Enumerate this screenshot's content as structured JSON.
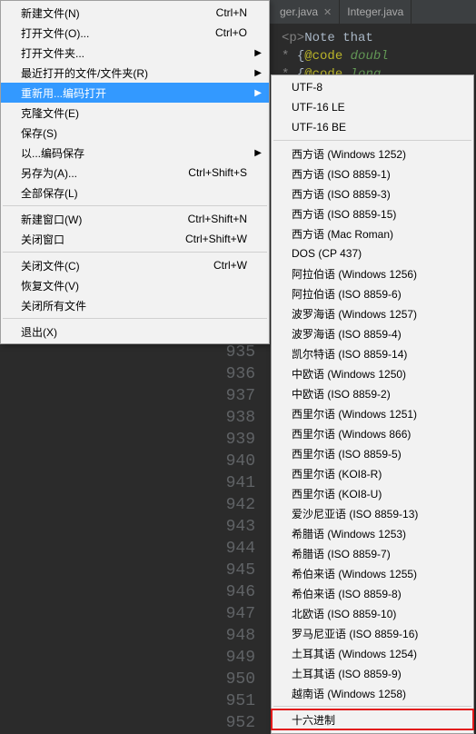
{
  "tabs": [
    {
      "label": "ger.java"
    },
    {
      "label": "Integer.java"
    }
  ],
  "code_top": {
    "l1_prefix": "<p>",
    "l1_text": "Note  that",
    "l2_star": "*",
    "l2_ann": "@code",
    "l2_kw": "doubl",
    "l3_star": "*",
    "l3_ann": "@code",
    "l3_kw": "long"
  },
  "gutter": [
    "935",
    "936",
    "937",
    "938",
    "939",
    "940",
    "941",
    "942",
    "943",
    "944",
    "945",
    "946",
    "947",
    "948",
    "949",
    "950",
    "951",
    "952"
  ],
  "menu": {
    "items": [
      {
        "label": "新建文件(N)",
        "shortcut": "Ctrl+N"
      },
      {
        "label": "打开文件(O)...",
        "shortcut": "Ctrl+O"
      },
      {
        "label": "打开文件夹...",
        "shortcut": "",
        "submenu": true
      },
      {
        "label": "最近打开的文件/文件夹(R)",
        "shortcut": "",
        "submenu": true
      },
      {
        "label": "重新用...编码打开",
        "shortcut": "",
        "submenu": true,
        "highlight": true
      },
      {
        "label": "克隆文件(E)",
        "shortcut": ""
      },
      {
        "label": "保存(S)",
        "shortcut": ""
      },
      {
        "label": "以...编码保存",
        "shortcut": "",
        "submenu": true
      },
      {
        "label": "另存为(A)...",
        "shortcut": "Ctrl+Shift+S"
      },
      {
        "label": "全部保存(L)",
        "shortcut": ""
      },
      {
        "sep": true
      },
      {
        "label": "新建窗口(W)",
        "shortcut": "Ctrl+Shift+N"
      },
      {
        "label": "关闭窗口",
        "shortcut": "Ctrl+Shift+W"
      },
      {
        "sep": true
      },
      {
        "label": "关闭文件(C)",
        "shortcut": "Ctrl+W"
      },
      {
        "label": "恢复文件(V)",
        "shortcut": ""
      },
      {
        "label": "关闭所有文件",
        "shortcut": ""
      },
      {
        "sep": true
      },
      {
        "label": "退出(X)",
        "shortcut": ""
      }
    ]
  },
  "submenu": {
    "groups": [
      [
        "UTF-8",
        "UTF-16 LE",
        "UTF-16 BE"
      ],
      [
        "西方语 (Windows 1252)",
        "西方语 (ISO 8859-1)",
        "西方语 (ISO 8859-3)",
        "西方语 (ISO 8859-15)",
        "西方语 (Mac Roman)",
        "DOS (CP 437)",
        "阿拉伯语 (Windows 1256)",
        "阿拉伯语 (ISO 8859-6)",
        "波罗海语 (Windows 1257)",
        "波罗海语 (ISO 8859-4)",
        "凯尔特语 (ISO 8859-14)",
        "中欧语 (Windows 1250)",
        "中欧语 (ISO 8859-2)",
        "西里尔语 (Windows 1251)",
        "西里尔语 (Windows 866)",
        "西里尔语 (ISO 8859-5)",
        "西里尔语 (KOI8-R)",
        "西里尔语 (KOI8-U)",
        "爱沙尼亚语 (ISO 8859-13)",
        "希腊语 (Windows 1253)",
        "希腊语 (ISO 8859-7)",
        "希伯来语 (Windows 1255)",
        "希伯来语 (ISO 8859-8)",
        "北欧语 (ISO 8859-10)",
        "罗马尼亚语 (ISO 8859-16)",
        "土耳其语 (Windows 1254)",
        "土耳其语 (ISO 8859-9)",
        "越南语 (Windows 1258)"
      ],
      [
        "十六进制"
      ]
    ]
  }
}
